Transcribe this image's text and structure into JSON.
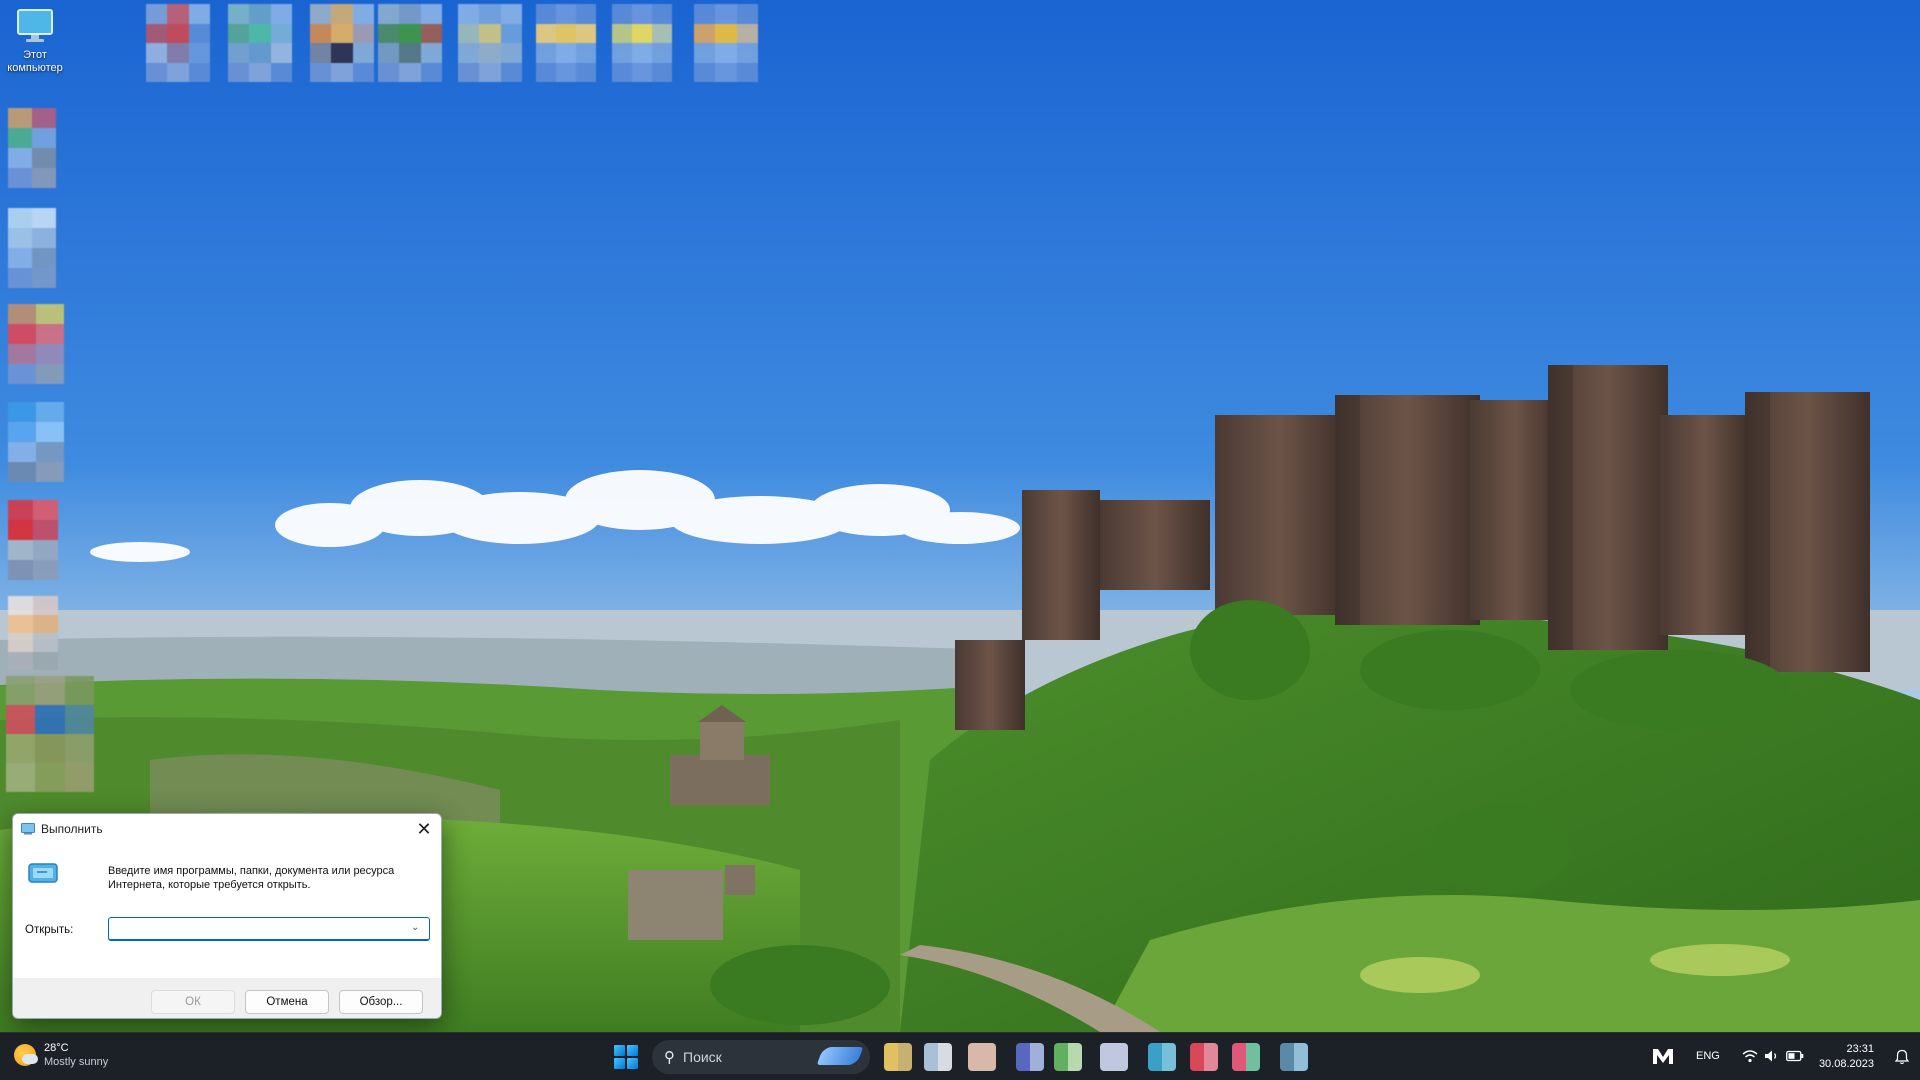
{
  "desktop": {
    "this_pc_label_line1": "Этот",
    "this_pc_label_line2": "компьютер"
  },
  "run_dialog": {
    "title": "Выполнить",
    "description_line1": "Введите имя программы, папки, документа или ресурса",
    "description_line2": "Интернета, которые требуется открыть.",
    "open_label": "Открыть:",
    "open_value": "",
    "ok_label": "ОК",
    "cancel_label": "Отмена",
    "browse_label": "Обзор..."
  },
  "taskbar": {
    "weather_temp": "28°C",
    "weather_condition": "Mostly sunny",
    "search_label": "Поиск",
    "language": "ENG",
    "time": "23:31",
    "date": "30.08.2023"
  },
  "colors": {
    "accent": "#0067c0",
    "taskbar_bg": "#1c2128"
  }
}
